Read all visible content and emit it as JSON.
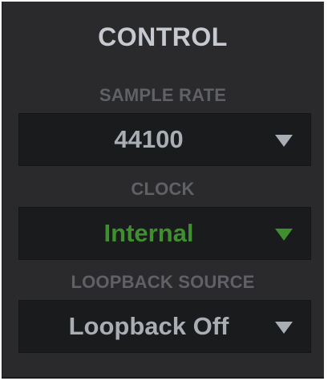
{
  "panel": {
    "title": "CONTROL"
  },
  "controls": [
    {
      "label": "SAMPLE RATE",
      "value": "44100",
      "state": "default"
    },
    {
      "label": "CLOCK",
      "value": "Internal",
      "state": "active"
    },
    {
      "label": "LOOPBACK SOURCE",
      "value": "Loopback Off",
      "state": "default"
    }
  ],
  "colors": {
    "panel_bg": "#2a2a2c",
    "select_bg": "#1a1b1d",
    "title": "#c6c9cf",
    "label": "#5f6166",
    "value": "#a9adb4",
    "active": "#3f8f2f"
  },
  "icons": {
    "dropdown": "triangle-down-icon"
  }
}
